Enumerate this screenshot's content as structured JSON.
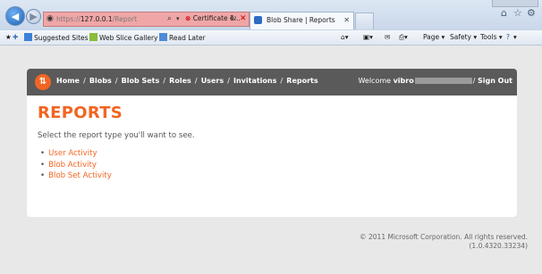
{
  "browser": {
    "address": {
      "scheme": "https://",
      "host": "127.0.0.1",
      "path": "/Report"
    },
    "cert_label": "Certificate e...",
    "tab_title": "Blob Share | Reports",
    "favorites": {
      "suggested_sites": "Suggested Sites ▾",
      "web_slice_gallery": "Web Slice Gallery ▾",
      "read_later": "Read Later"
    },
    "commands": {
      "page": "Page ▾",
      "safety": "Safety ▾",
      "tools": "Tools ▾",
      "help": "▾"
    }
  },
  "site": {
    "nav": [
      "Home",
      "Blobs",
      "Blob Sets",
      "Roles",
      "Users",
      "Invitations",
      "Reports"
    ],
    "welcome": "Welcome",
    "username_visible": "vibro",
    "username_tail": "/",
    "sign_out": "Sign Out",
    "page_title": "REPORTS",
    "intro": "Select the report type you'll want to see.",
    "reports": [
      "User Activity",
      "Blob Activity",
      "Blob Set Activity"
    ],
    "footer_line1": "© 2011 Microsoft Corporation. All rights reserved.",
    "footer_line2": "(1.0.4320.33234)"
  },
  "colors": {
    "accent": "#f26522",
    "header": "#5a5a5a"
  }
}
